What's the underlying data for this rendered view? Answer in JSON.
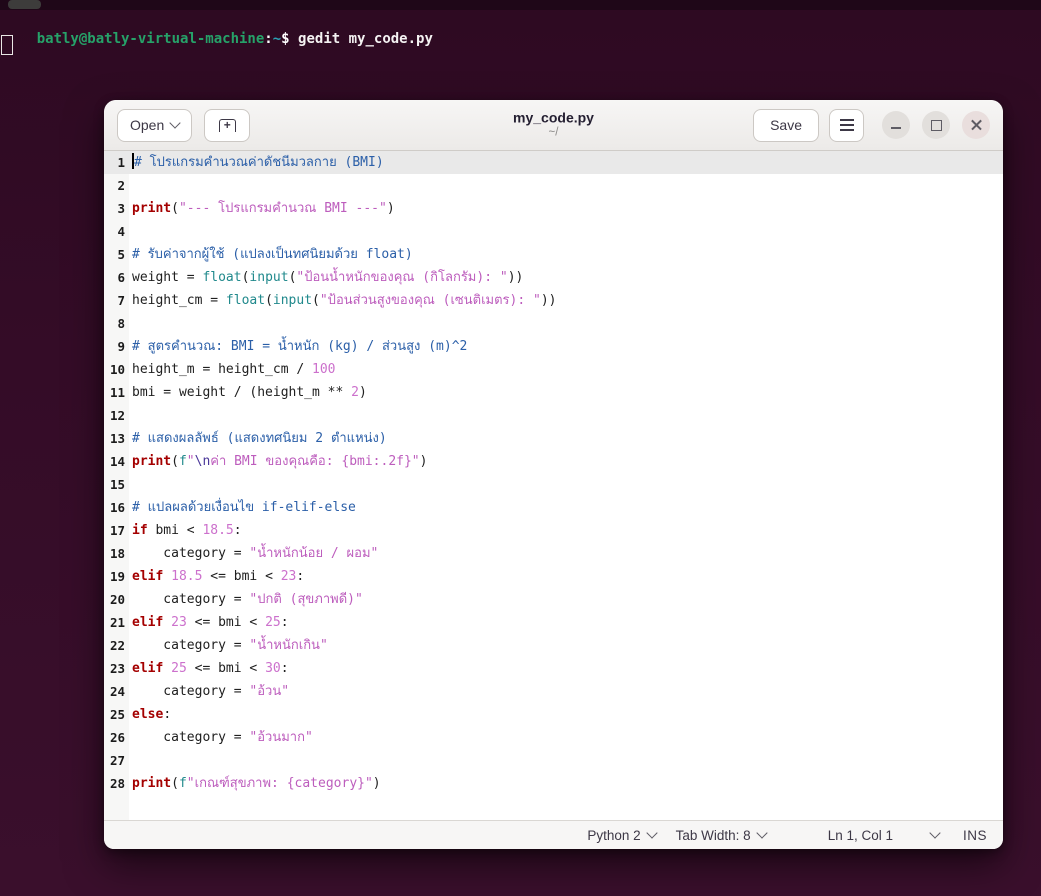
{
  "terminal": {
    "prompt_user": "batly@batly-virtual-machine",
    "prompt_colon": ":",
    "prompt_path": "~",
    "prompt_dollar": "$",
    "command": " gedit my_code.py"
  },
  "window": {
    "open_label": "Open",
    "save_label": "Save",
    "title": "my_code.py",
    "subtitle": "~/"
  },
  "statusbar": {
    "language": "Python 2",
    "tab_width": "Tab Width: 8",
    "cursor_position": "Ln 1, Col 1",
    "overwrite_mode": "INS"
  },
  "colors": {
    "keyword": "#a40000",
    "builtin": "#20898c",
    "string": "#bd5dbd",
    "number": "#cc70cc",
    "escape": "#4a3699",
    "comment": "#2b5fa8",
    "terminal_green": "#26a269",
    "terminal_cyan": "#2aa1b3",
    "terminal_bg": "#340c27"
  },
  "editor": {
    "current_line": 1,
    "lines": [
      [
        [
          "com",
          "# โปรแกรมคำนวณค่าดัชนีมวลกาย (BMI)"
        ]
      ],
      [],
      [
        [
          "kw",
          "print"
        ],
        [
          "pl",
          "("
        ],
        [
          "str",
          "\"--- โปรแกรมคำนวณ BMI ---\""
        ],
        [
          "pl",
          ")"
        ]
      ],
      [],
      [
        [
          "com",
          "# รับค่าจากผู้ใช้ (แปลงเป็นทศนิยมด้วย float)"
        ]
      ],
      [
        [
          "pl",
          "weight = "
        ],
        [
          "bi",
          "float"
        ],
        [
          "pl",
          "("
        ],
        [
          "bi",
          "input"
        ],
        [
          "pl",
          "("
        ],
        [
          "str",
          "\"ป้อนน้ำหนักของคุณ (กิโลกรัม): \""
        ],
        [
          "pl",
          "))"
        ]
      ],
      [
        [
          "pl",
          "height_cm = "
        ],
        [
          "bi",
          "float"
        ],
        [
          "pl",
          "("
        ],
        [
          "bi",
          "input"
        ],
        [
          "pl",
          "("
        ],
        [
          "str",
          "\"ป้อนส่วนสูงของคุณ (เซนติเมตร): \""
        ],
        [
          "pl",
          "))"
        ]
      ],
      [],
      [
        [
          "com",
          "# สูตรคำนวณ: BMI = น้ำหนัก (kg) / ส่วนสูง (m)^2"
        ]
      ],
      [
        [
          "pl",
          "height_m = height_cm / "
        ],
        [
          "num",
          "100"
        ]
      ],
      [
        [
          "pl",
          "bmi = weight / (height_m ** "
        ],
        [
          "num",
          "2"
        ],
        [
          "pl",
          ")"
        ]
      ],
      [],
      [
        [
          "com",
          "# แสดงผลลัพธ์ (แสดงทศนิยม 2 ตำแหน่ง)"
        ]
      ],
      [
        [
          "kw",
          "print"
        ],
        [
          "pl",
          "("
        ],
        [
          "bi",
          "f"
        ],
        [
          "str",
          "\""
        ],
        [
          "esc",
          "\\n"
        ],
        [
          "str",
          "ค่า BMI ของคุณคือ: {bmi:.2f}\""
        ],
        [
          "pl",
          ")"
        ]
      ],
      [],
      [
        [
          "com",
          "# แปลผลด้วยเงื่อนไข if-elif-else"
        ]
      ],
      [
        [
          "kw",
          "if"
        ],
        [
          "pl",
          " bmi < "
        ],
        [
          "num",
          "18.5"
        ],
        [
          "pl",
          ":"
        ]
      ],
      [
        [
          "pl",
          "    category = "
        ],
        [
          "str",
          "\"น้ำหนักน้อย / ผอม\""
        ]
      ],
      [
        [
          "kw",
          "elif"
        ],
        [
          "pl",
          " "
        ],
        [
          "num",
          "18.5"
        ],
        [
          "pl",
          " <= bmi < "
        ],
        [
          "num",
          "23"
        ],
        [
          "pl",
          ":"
        ]
      ],
      [
        [
          "pl",
          "    category = "
        ],
        [
          "str",
          "\"ปกติ (สุขภาพดี)\""
        ]
      ],
      [
        [
          "kw",
          "elif"
        ],
        [
          "pl",
          " "
        ],
        [
          "num",
          "23"
        ],
        [
          "pl",
          " <= bmi < "
        ],
        [
          "num",
          "25"
        ],
        [
          "pl",
          ":"
        ]
      ],
      [
        [
          "pl",
          "    category = "
        ],
        [
          "str",
          "\"น้ำหนักเกิน\""
        ]
      ],
      [
        [
          "kw",
          "elif"
        ],
        [
          "pl",
          " "
        ],
        [
          "num",
          "25"
        ],
        [
          "pl",
          " <= bmi < "
        ],
        [
          "num",
          "30"
        ],
        [
          "pl",
          ":"
        ]
      ],
      [
        [
          "pl",
          "    category = "
        ],
        [
          "str",
          "\"อ้วน\""
        ]
      ],
      [
        [
          "kw",
          "else"
        ],
        [
          "pl",
          ":"
        ]
      ],
      [
        [
          "pl",
          "    category = "
        ],
        [
          "str",
          "\"อ้วนมาก\""
        ]
      ],
      [],
      [
        [
          "kw",
          "print"
        ],
        [
          "pl",
          "("
        ],
        [
          "bi",
          "f"
        ],
        [
          "str",
          "\"เกณฑ์สุขภาพ: {category}\""
        ],
        [
          "pl",
          ")"
        ]
      ]
    ]
  }
}
